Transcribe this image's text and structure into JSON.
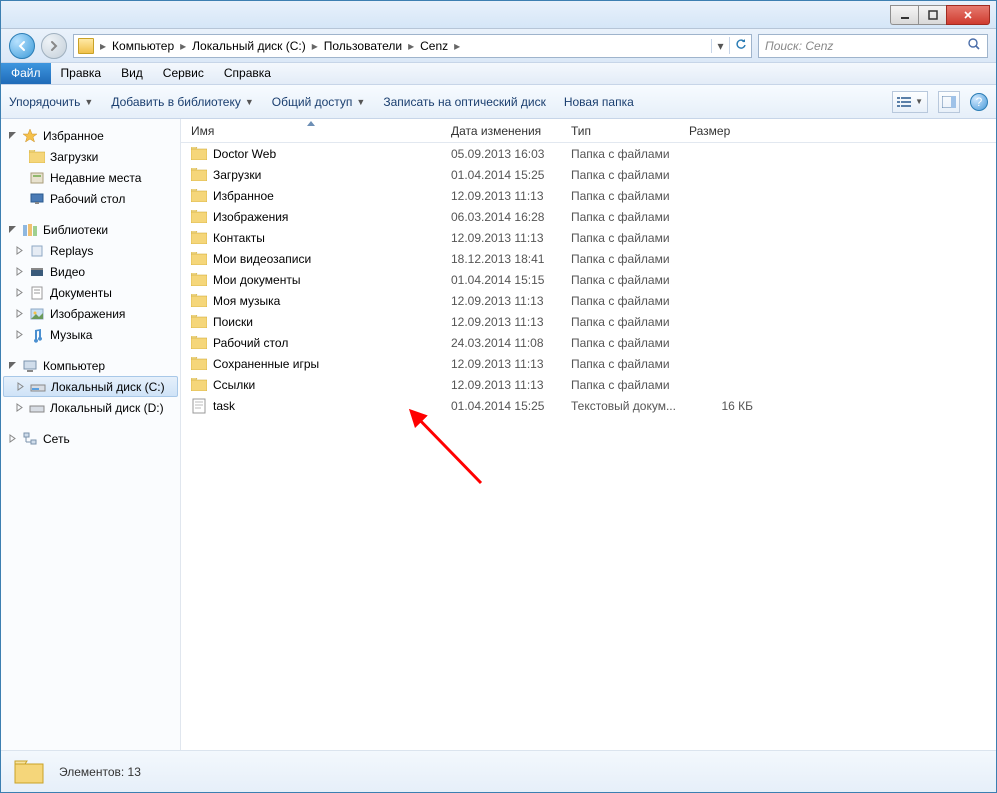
{
  "breadcrumb": {
    "items": [
      "Компьютер",
      "Локальный диск (C:)",
      "Пользователи",
      "Cenz"
    ]
  },
  "search": {
    "placeholder": "Поиск: Cenz"
  },
  "menubar": {
    "file": "Файл",
    "edit": "Правка",
    "view": "Вид",
    "tools": "Сервис",
    "help": "Справка"
  },
  "toolbar": {
    "organize": "Упорядочить",
    "library": "Добавить в библиотеку",
    "share": "Общий доступ",
    "burn": "Записать на оптический диск",
    "newfolder": "Новая папка"
  },
  "columns": {
    "name": "Имя",
    "date": "Дата изменения",
    "type": "Тип",
    "size": "Размер"
  },
  "tree": {
    "favorites": {
      "label": "Избранное",
      "items": [
        "Загрузки",
        "Недавние места",
        "Рабочий стол"
      ]
    },
    "libraries": {
      "label": "Библиотеки",
      "items": [
        "Replays",
        "Видео",
        "Документы",
        "Изображения",
        "Музыка"
      ]
    },
    "computer": {
      "label": "Компьютер",
      "items": [
        "Локальный диск (C:)",
        "Локальный диск (D:)"
      ]
    },
    "network": {
      "label": "Сеть"
    }
  },
  "files": [
    {
      "name": "Doctor Web",
      "date": "05.09.2013 16:03",
      "type": "Папка с файлами",
      "size": "",
      "icon": "folder"
    },
    {
      "name": "Загрузки",
      "date": "01.04.2014 15:25",
      "type": "Папка с файлами",
      "size": "",
      "icon": "folder"
    },
    {
      "name": "Избранное",
      "date": "12.09.2013 11:13",
      "type": "Папка с файлами",
      "size": "",
      "icon": "folder-fav"
    },
    {
      "name": "Изображения",
      "date": "06.03.2014 16:28",
      "type": "Папка с файлами",
      "size": "",
      "icon": "folder-pic"
    },
    {
      "name": "Контакты",
      "date": "12.09.2013 11:13",
      "type": "Папка с файлами",
      "size": "",
      "icon": "folder-contact"
    },
    {
      "name": "Мои видеозаписи",
      "date": "18.12.2013 18:41",
      "type": "Папка с файлами",
      "size": "",
      "icon": "folder-vid"
    },
    {
      "name": "Мои документы",
      "date": "01.04.2014 15:15",
      "type": "Папка с файлами",
      "size": "",
      "icon": "folder-doc"
    },
    {
      "name": "Моя музыка",
      "date": "12.09.2013 11:13",
      "type": "Папка с файлами",
      "size": "",
      "icon": "folder-music"
    },
    {
      "name": "Поиски",
      "date": "12.09.2013 11:13",
      "type": "Папка с файлами",
      "size": "",
      "icon": "folder-search"
    },
    {
      "name": "Рабочий стол",
      "date": "24.03.2014 11:08",
      "type": "Папка с файлами",
      "size": "",
      "icon": "folder-desk"
    },
    {
      "name": "Сохраненные игры",
      "date": "12.09.2013 11:13",
      "type": "Папка с файлами",
      "size": "",
      "icon": "folder-game"
    },
    {
      "name": "Ссылки",
      "date": "12.09.2013 11:13",
      "type": "Папка с файлами",
      "size": "",
      "icon": "folder-link"
    },
    {
      "name": "task",
      "date": "01.04.2014 15:25",
      "type": "Текстовый докум...",
      "size": "16 КБ",
      "icon": "txt"
    }
  ],
  "status": {
    "label": "Элементов: 13"
  },
  "tree_icons": {
    "downloads": "downloads-icon",
    "recent": "recent-icon",
    "desktop": "desktop-icon",
    "replays": "library-icon",
    "video": "video-library-icon",
    "docs": "docs-library-icon",
    "images": "images-library-icon",
    "music": "music-library-icon"
  }
}
